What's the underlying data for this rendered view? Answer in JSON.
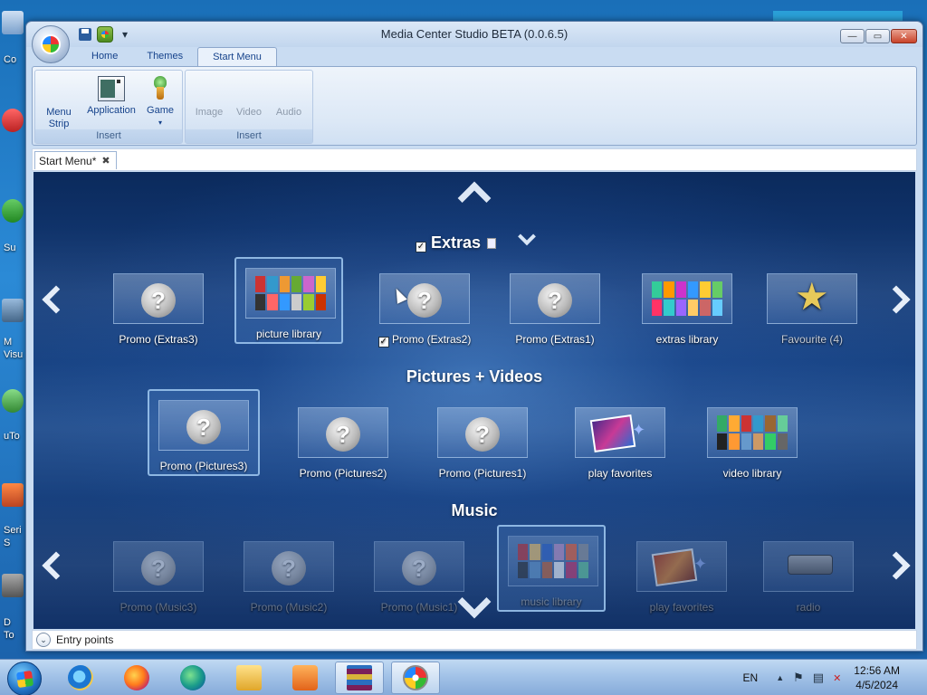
{
  "desktop": {
    "labels": [
      "Co",
      "Su",
      "M",
      "Visu",
      "uTo",
      "Seri",
      "S",
      "D",
      "To"
    ]
  },
  "window": {
    "title": "Media Center Studio BETA (0.0.6.5)",
    "qat_more": "▾",
    "controls": {
      "minimize": "—",
      "maximize": "▭",
      "close": "✕"
    }
  },
  "ribbon": {
    "tabs": [
      "Home",
      "Themes",
      "Start Menu"
    ],
    "active_tab": "Start Menu",
    "groups": [
      {
        "label": "Insert",
        "buttons": [
          "Menu Strip",
          "Application",
          "Game"
        ]
      },
      {
        "label": "Insert",
        "buttons": [
          "Image",
          "Video",
          "Audio"
        ]
      }
    ],
    "game_dropdown": "▾"
  },
  "doc_tab": {
    "label": "Start Menu*",
    "close": "✖"
  },
  "canvas": {
    "sections": [
      {
        "title": "Extras",
        "checked": true,
        "tiles": [
          {
            "label": "Promo (Extras3)",
            "kind": "promo"
          },
          {
            "label": "picture library",
            "kind": "mosaic",
            "focused": true
          },
          {
            "label": "Promo (Extras2)",
            "kind": "promo",
            "checked": true
          },
          {
            "label": "Promo (Extras1)",
            "kind": "promo"
          },
          {
            "label": "extras library",
            "kind": "mosaic"
          },
          {
            "label": "Favourite (4)",
            "kind": "star"
          }
        ]
      },
      {
        "title": "Pictures + Videos",
        "tiles": [
          {
            "label": "Promo (Pictures3)",
            "kind": "promo",
            "focused": true
          },
          {
            "label": "Promo (Pictures2)",
            "kind": "promo"
          },
          {
            "label": "Promo (Pictures1)",
            "kind": "promo"
          },
          {
            "label": "play favorites",
            "kind": "fan"
          },
          {
            "label": "video library",
            "kind": "mosaic"
          }
        ]
      },
      {
        "title": "Music",
        "tiles": [
          {
            "label": "Promo (Music3)",
            "kind": "promo"
          },
          {
            "label": "Promo (Music2)",
            "kind": "promo"
          },
          {
            "label": "Promo (Music1)",
            "kind": "promo"
          },
          {
            "label": "music library",
            "kind": "mosaic",
            "focused": true
          },
          {
            "label": "play favorites",
            "kind": "fan-orange"
          },
          {
            "label": "radio",
            "kind": "radio"
          }
        ]
      }
    ],
    "question_glyph": "?",
    "star_glyph": "★",
    "check_glyph": "✓",
    "sparkle_glyph": "✦"
  },
  "statusbar": {
    "label": "Entry points",
    "chevron": "⌄"
  },
  "taskbar": {
    "apps": [
      "internet-explorer",
      "firefox",
      "edge",
      "file-explorer",
      "media-player",
      "winrar",
      "media-center-studio"
    ],
    "active_app": "media-center-studio",
    "tray": {
      "lang": "EN",
      "arrow": "▲",
      "flag": "⚑",
      "network": "▤",
      "volume": "✕"
    },
    "clock": {
      "time": "12:56 AM",
      "date": "4/5/2024"
    }
  },
  "colors": {
    "canvas_top": "#0b2a5c",
    "canvas_mid": "#1c4a8c",
    "ribbon_text": "#15428b",
    "ribbon_bg": "#dce8f6"
  }
}
